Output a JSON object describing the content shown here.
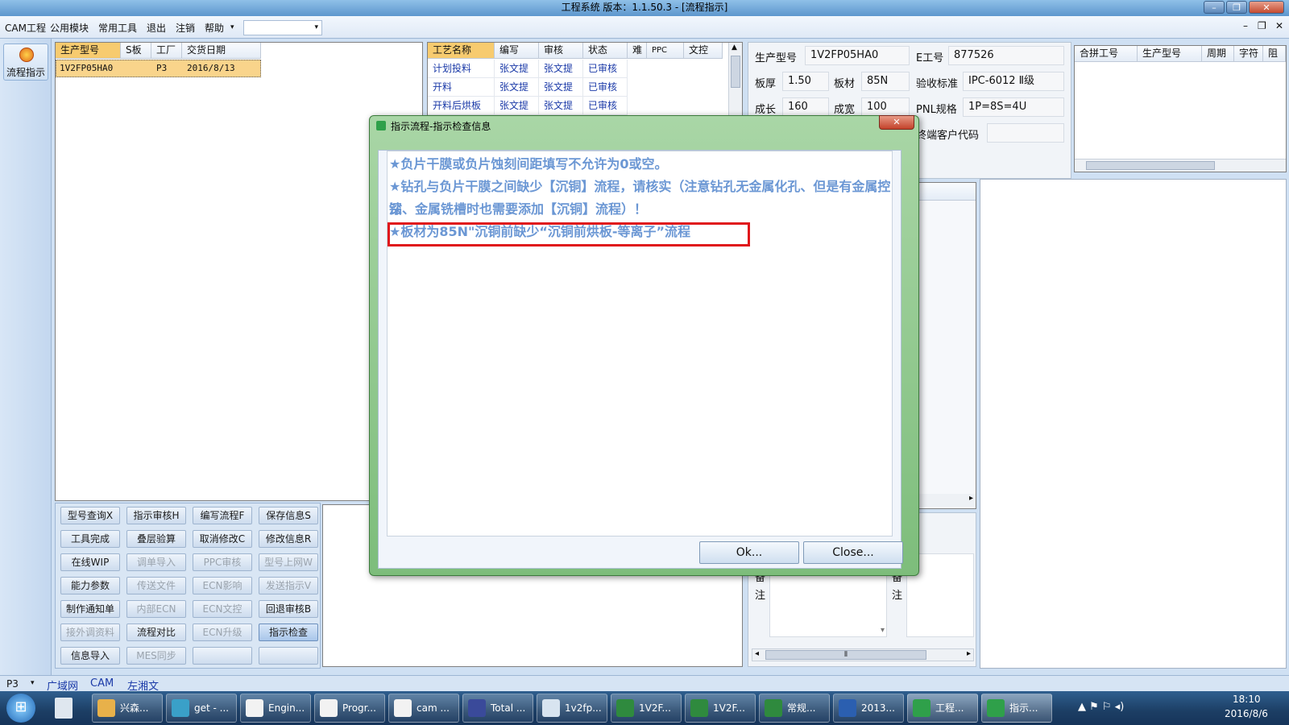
{
  "window": {
    "title": "工程系统   版本：1.1.50.3 - [流程指示]",
    "min": "–",
    "restore": "❐",
    "close": "✕"
  },
  "menu": {
    "items": [
      "CAM工程",
      "公用模块",
      "常用工具",
      "退出",
      "注销",
      "帮助"
    ],
    "help_arrow": "▾",
    "combo_arrow": "▾",
    "mdi_min": "–",
    "mdi_restore": "❐",
    "mdi_close": "✕"
  },
  "sidebar": {
    "label": "流程指示"
  },
  "orders": {
    "headers": [
      "生产型号",
      "S板",
      "工厂",
      "交货日期"
    ],
    "rows": [
      [
        "1V2FP05HA0",
        "",
        "P3",
        "2016/8/13"
      ]
    ]
  },
  "process": {
    "headers": [
      "工艺名称",
      "编写",
      "审核",
      "状态",
      "难",
      "PPC",
      "文控"
    ],
    "rows": [
      [
        "计划投料",
        "张文提",
        "张文提",
        "已审核"
      ],
      [
        "开料",
        "张文提",
        "张文提",
        "已审核"
      ],
      [
        "开料后烘板",
        "张文提",
        "张文提",
        "已审核"
      ]
    ],
    "scroll_up": "▲"
  },
  "info": {
    "model_label": "生产型号",
    "model": "1V2FP05HA0",
    "eno_label": "E工号",
    "eno": "877526",
    "thick_label": "板厚",
    "thick": "1.50",
    "mat_label": "板材",
    "mat": "85N",
    "std_label": "验收标准",
    "std": "IPC-6012 Ⅱ级",
    "len_label": "成长",
    "len": "160",
    "wid_label": "成宽",
    "wid": "100",
    "pnl_label": "PNL规格",
    "pnl": "1P=8S=4U",
    "cust_label": "终端客户代码"
  },
  "merge": {
    "headers": [
      "合拼工号",
      "生产型号",
      "周期",
      "字符",
      "阻焊"
    ]
  },
  "buttons": [
    [
      "型号查询X",
      "指示审核H",
      "编写流程F",
      "保存信息S"
    ],
    [
      "工具完成",
      "叠层验算",
      "取消修改C",
      "修改信息R"
    ],
    [
      "在线WIP",
      "调单导入",
      "PPC审核",
      "型号上网W"
    ],
    [
      "能力参数",
      "传送文件",
      "ECN影响",
      "发送指示V"
    ],
    [
      "制作通知单",
      "内部ECN",
      "ECN文控",
      "回退审核B"
    ],
    [
      "接外调资料",
      "流程对比",
      "ECN升级",
      "指示检查"
    ],
    [
      "信息导入",
      "MES同步",
      "",
      ""
    ]
  ],
  "remark": {
    "label1": "备注",
    "label2": "备注",
    "scroll_down": "▾",
    "hscroll": "⦀",
    "left": "◂",
    "right": "▸"
  },
  "dialog": {
    "title": "指示流程-指示检查信息",
    "close": "✕",
    "lines": [
      "★负片干膜或负片蚀刻间距填写不允许为0或空。",
      "★钻孔与负片干膜之间缺少【沉铜】流程，请核实（注意钻孔无金属化孔、但是有金属控深",
      "钻、金属铣槽时也需要添加【沉铜】流程）！",
      "★板材为85N\"沉铜前缺少“沉铜前烘板-等离子”流程"
    ],
    "ok": "Ok...",
    "cancel": "Close..."
  },
  "status": {
    "factory": "P3",
    "arrow": "▾",
    "items": [
      "广域网",
      "CAM",
      "左湘文"
    ]
  },
  "taskbar": {
    "items": [
      "兴森...",
      "get - ...",
      "Engin...",
      "Progr...",
      "cam ...",
      "Total ...",
      "1v2fp...",
      "1V2F...",
      "1V2F...",
      "常规...",
      "2013...",
      "工程...",
      "指示..."
    ],
    "time": "18:10",
    "date": "2016/8/6",
    "start": "⊞",
    "tray": "▲ ⚑ ⚐ ◂) "
  },
  "colors": {
    "accent": "#f7cb6f",
    "highlight_box": "#e0161b",
    "msg_text": "#6b97d4"
  }
}
